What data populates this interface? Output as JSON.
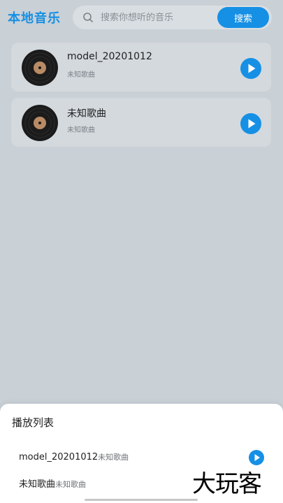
{
  "header": {
    "title": "本地音乐",
    "search_placeholder": "搜索你想听的音乐",
    "search_button": "搜索"
  },
  "songs": [
    {
      "title": "model_20201012",
      "artist": "未知歌曲"
    },
    {
      "title": "未知歌曲",
      "artist": "未知歌曲"
    }
  ],
  "mini_player": {
    "title": "model_20201012"
  },
  "playlist": {
    "title": "播放列表",
    "items": [
      {
        "title": "model_20201012",
        "artist": "未知歌曲"
      },
      {
        "title": "未知歌曲",
        "artist": "未知歌曲"
      }
    ]
  },
  "watermark": "大玩客",
  "colors": {
    "accent": "#1690e4",
    "background": "#c9d0d6",
    "card": "#d4d9de"
  },
  "icons": {
    "search": "search-icon",
    "disc": "vinyl-disc-icon",
    "play": "play-icon"
  }
}
